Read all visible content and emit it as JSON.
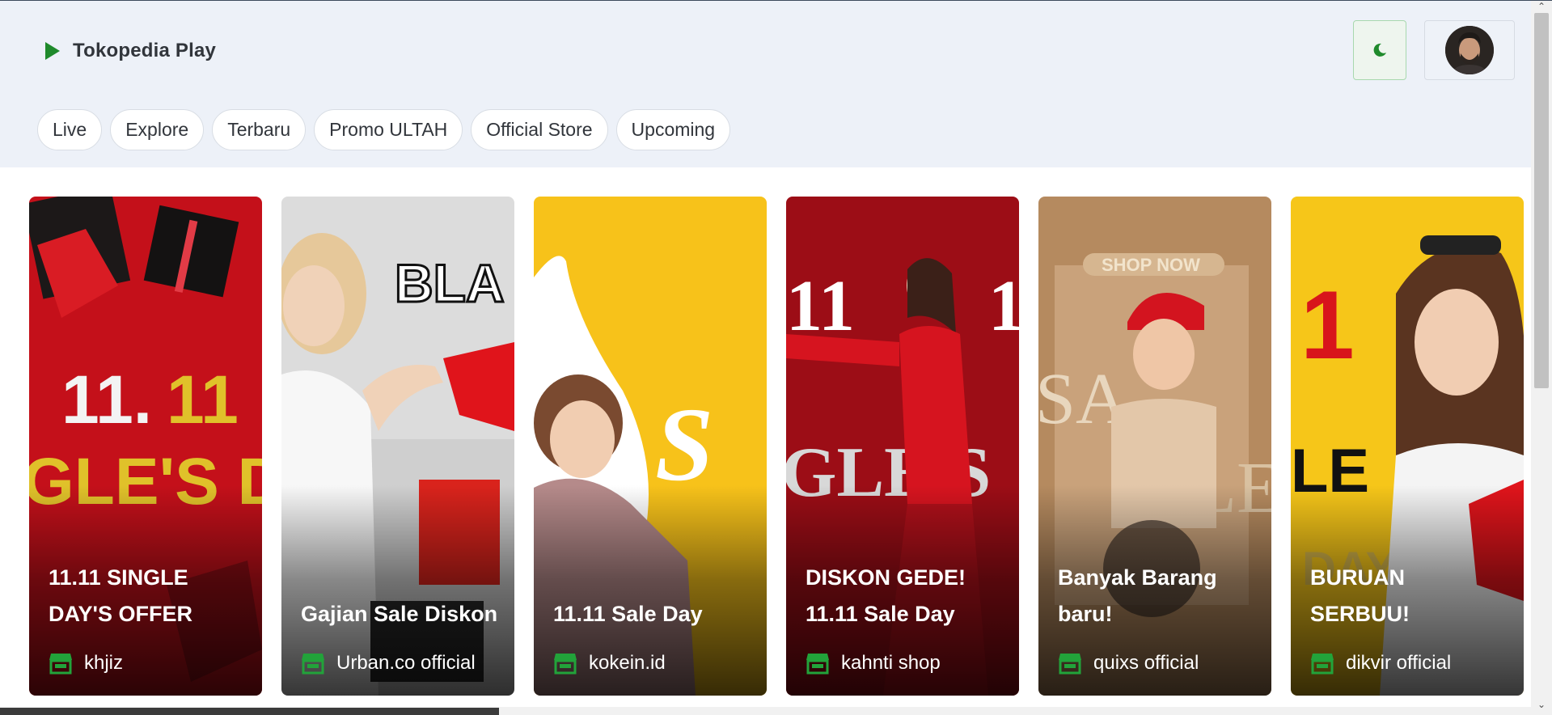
{
  "header": {
    "brand": "Tokopedia Play",
    "theme_toggle_icon": "moon-icon",
    "avatar_icon": "user-avatar"
  },
  "tabs": [
    {
      "label": "Live"
    },
    {
      "label": "Explore"
    },
    {
      "label": "Terbaru"
    },
    {
      "label": "Promo ULTAH"
    },
    {
      "label": "Official Store"
    },
    {
      "label": "Upcoming"
    }
  ],
  "cards": [
    {
      "title": "11.11 SINGLE DAY'S OFFER",
      "shop": "khjiz",
      "overlay": "11.11 GLE'S D",
      "color": "#c4101a"
    },
    {
      "title": "Gajian Sale Diskon",
      "shop": "Urban.co official",
      "overlay": "BLA",
      "color": "#d8d8d8"
    },
    {
      "title": "11.11 Sale Day",
      "shop": "kokein.id",
      "overlay": "S",
      "color": "#f7c21a"
    },
    {
      "title": "DISKON GEDE! 11.11 Sale Day",
      "shop": "kahnti shop",
      "overlay": "11 1 GLE'S",
      "color": "#9c0d16"
    },
    {
      "title": "Banyak Barang baru!",
      "shop": "quixs official",
      "overlay": "SHOP NOW",
      "color": "#b58a5f"
    },
    {
      "title": "BURUAN SERBUU!",
      "shop": "dikvir official",
      "overlay": "1 LE DAY",
      "color": "#f6c619"
    }
  ],
  "colors": {
    "accent": "#1f8a2c",
    "header_bg": "#edf1f8"
  }
}
